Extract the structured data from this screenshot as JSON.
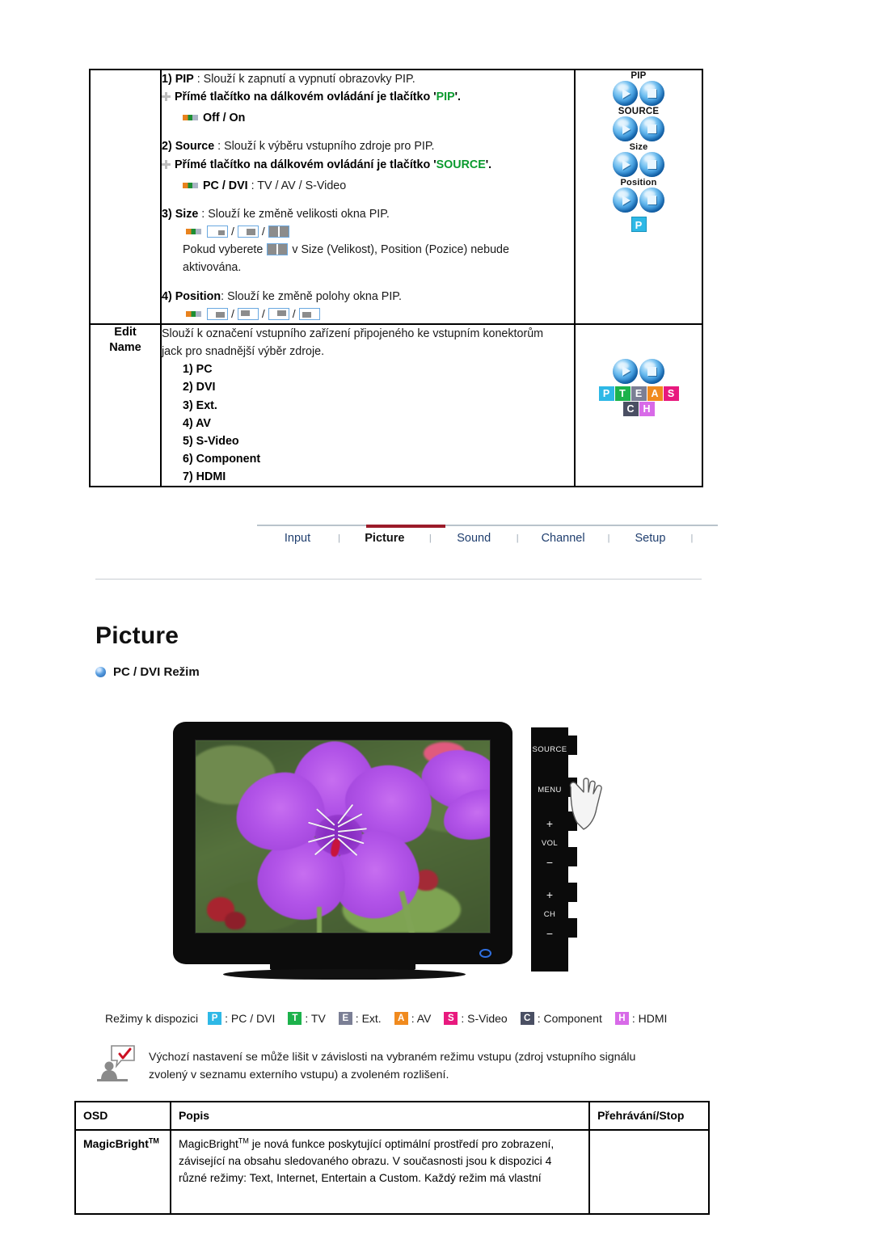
{
  "spec_table": {
    "pip_row": {
      "label": "",
      "items": [
        {
          "num": "1)",
          "name": "PIP",
          "sep": " : ",
          "desc": "Slouží k zapnutí a vypnutí obrazovky PIP.",
          "remote_prefix": "Přímé tlačítko na dálkovém ovládání je tlačítko '",
          "remote_key": "PIP",
          "remote_suffix": "'.",
          "options": "Off / On"
        },
        {
          "num": "2)",
          "name": "Source",
          "sep": " : ",
          "desc": "Slouží k výběru vstupního zdroje pro PIP.",
          "remote_prefix": "Přímé tlačítko na dálkovém ovládání je tlačítko '",
          "remote_key": "SOURCE",
          "remote_suffix": "'.",
          "options_bold": "PC / DVI",
          "options_rest": " : TV / AV / S-Video"
        },
        {
          "num": "3)",
          "name": "Size",
          "sep": " : ",
          "desc": "Slouží ke změně velikosti okna PIP.",
          "note_before": "Pokud vyberete",
          "note_after": "v Size (Velikost), Position (Pozice) nebude",
          "note_line2": "aktivována."
        },
        {
          "num": "4)",
          "name": "Position",
          "sep": ": ",
          "desc": "Slouží ke změně polohy okna PIP."
        }
      ],
      "buttons": [
        {
          "label": "PIP"
        },
        {
          "label": "SOURCE"
        },
        {
          "label": "Size"
        },
        {
          "label": "Position"
        }
      ],
      "p_badge": "P"
    },
    "edit_name_row": {
      "label_line1": "Edit",
      "label_line2": "Name",
      "desc_line1": "Slouží k označení vstupního zařízení připojeného ke vstupním konektorům",
      "desc_line2": "jack pro snadnější výběr zdroje.",
      "items": [
        "1) PC",
        "2) DVI",
        "3) Ext.",
        "4) AV",
        "5) S-Video",
        "6) Component",
        "7) HDMI"
      ],
      "badges_row1": [
        {
          "letter": "P",
          "color": "#2eb8e6"
        },
        {
          "letter": "T",
          "color": "#1cb24b"
        },
        {
          "letter": "E",
          "color": "#7b7f95"
        },
        {
          "letter": "A",
          "color": "#f08a1e"
        },
        {
          "letter": "S",
          "color": "#e8197e"
        }
      ],
      "badges_row2": [
        {
          "letter": "C",
          "color": "#4a4f63"
        },
        {
          "letter": "H",
          "color": "#d86ae8"
        }
      ]
    }
  },
  "nav": {
    "tabs": [
      {
        "label": "Input",
        "active": false
      },
      {
        "label": "Picture",
        "active": true
      },
      {
        "label": "Sound",
        "active": false
      },
      {
        "label": "Channel",
        "active": false
      },
      {
        "label": "Setup",
        "active": false
      }
    ],
    "divider": "|",
    "active_color": "#9b1b29"
  },
  "page": {
    "heading": "Picture",
    "subheading": "PC / DVI Režim"
  },
  "monitor": {
    "controls": [
      {
        "type": "label",
        "text": "SOURCE"
      },
      {
        "type": "label",
        "text": "MENU"
      },
      {
        "type": "sign",
        "text": "+"
      },
      {
        "type": "label",
        "text": "VOL"
      },
      {
        "type": "sign",
        "text": "−"
      },
      {
        "type": "sign",
        "text": "+"
      },
      {
        "type": "label",
        "text": "CH"
      },
      {
        "type": "sign",
        "text": "−"
      }
    ]
  },
  "legend": {
    "lead": "Režimy k dispozici",
    "items": [
      {
        "letter": "P",
        "color": "#2eb8e6",
        "text": ": PC / DVI"
      },
      {
        "letter": "T",
        "color": "#1cb24b",
        "text": ": TV"
      },
      {
        "letter": "E",
        "color": "#7b7f95",
        "text": ": Ext."
      },
      {
        "letter": "A",
        "color": "#f08a1e",
        "text": ": AV"
      },
      {
        "letter": "S",
        "color": "#e8197e",
        "text": ": S-Video"
      },
      {
        "letter": "C",
        "color": "#4a4f63",
        "text": ": Component"
      },
      {
        "letter": "H",
        "color": "#d86ae8",
        "text": ": HDMI"
      }
    ]
  },
  "note": {
    "line1": "Výchozí nastavení se může lišit v závislosti na vybraném režimu vstupu (zdroj vstupního signálu",
    "line2": "zvolený v seznamu externího vstupu) a zvoleném rozlišení."
  },
  "osd_table": {
    "headers": [
      "OSD",
      "Popis",
      "Přehrávání/Stop"
    ],
    "rows": [
      {
        "osd": "MagicBright",
        "osd_sup": "TM",
        "desc_lead": "MagicBright",
        "desc_sup": "TM",
        "desc_rest": " je nová funkce poskytující optimální prostředí pro zobrazení, závisející na obsahu sledovaného obrazu. V současnosti jsou k dispozici 4 různé režimy: Text, Internet, Entertain a Custom. Každý režim má vlastní",
        "play": ""
      }
    ]
  }
}
